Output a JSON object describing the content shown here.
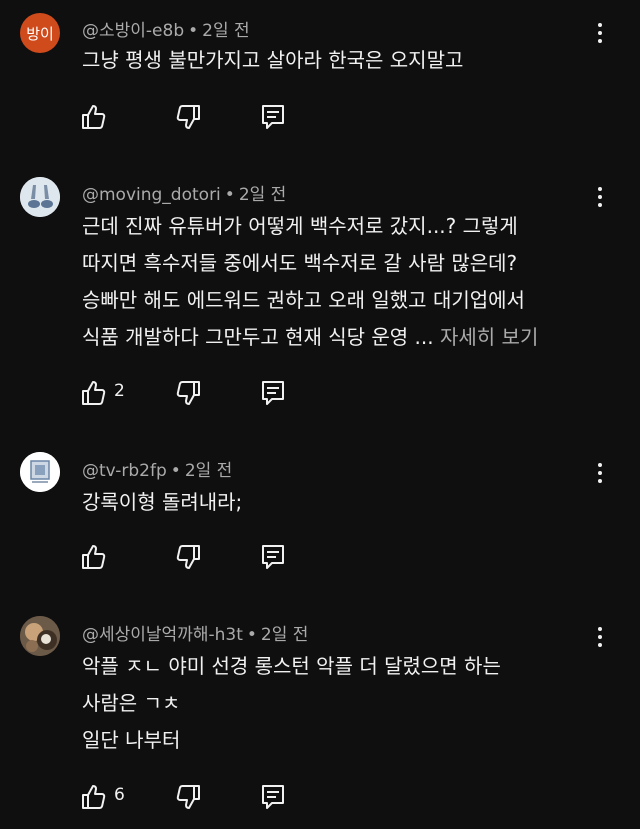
{
  "comments": [
    {
      "author": "@소방이-e8b",
      "time": "2일 전",
      "avatar_text": "방이",
      "lines": [
        "그냥 평생 불만가지고 살아라 한국은 오지말고"
      ],
      "likes": ""
    },
    {
      "author": "@moving_dotori",
      "time": "2일 전",
      "lines": [
        "근데 진짜 유튜버가 어떻게 백수저로 갔지...? 그렇게",
        "따지면 흑수저들 중에서도 백수저로 갈 사람 많은데?",
        "승빠만 해도 에드워드 권하고 오래 일했고 대기업에서",
        "식품 개발하다 그만두고 현재 식당 운영 ..."
      ],
      "more_label": "자세히 보기",
      "likes": "2"
    },
    {
      "author": "@tv-rb2fp",
      "time": "2일 전",
      "lines": [
        "강록이형 돌려내라;"
      ],
      "likes": ""
    },
    {
      "author": "@세상이날억까해-h3t",
      "time": "2일 전",
      "lines": [
        "악플 ㅈㄴ 야미 선경 롱스턴 악플 더 달렸으면 하는",
        "사람은 ㄱㅊ",
        "일단 나부터"
      ],
      "likes": "6"
    }
  ],
  "separator": "•",
  "colors": {
    "background": "#0f0f0f",
    "text": "#f1f1f1",
    "secondary": "#aaaaaa",
    "avatar_orange": "#cf4b1c"
  },
  "icons": [
    "thumbs-up-icon",
    "thumbs-down-icon",
    "reply-icon",
    "more-vert-icon"
  ]
}
